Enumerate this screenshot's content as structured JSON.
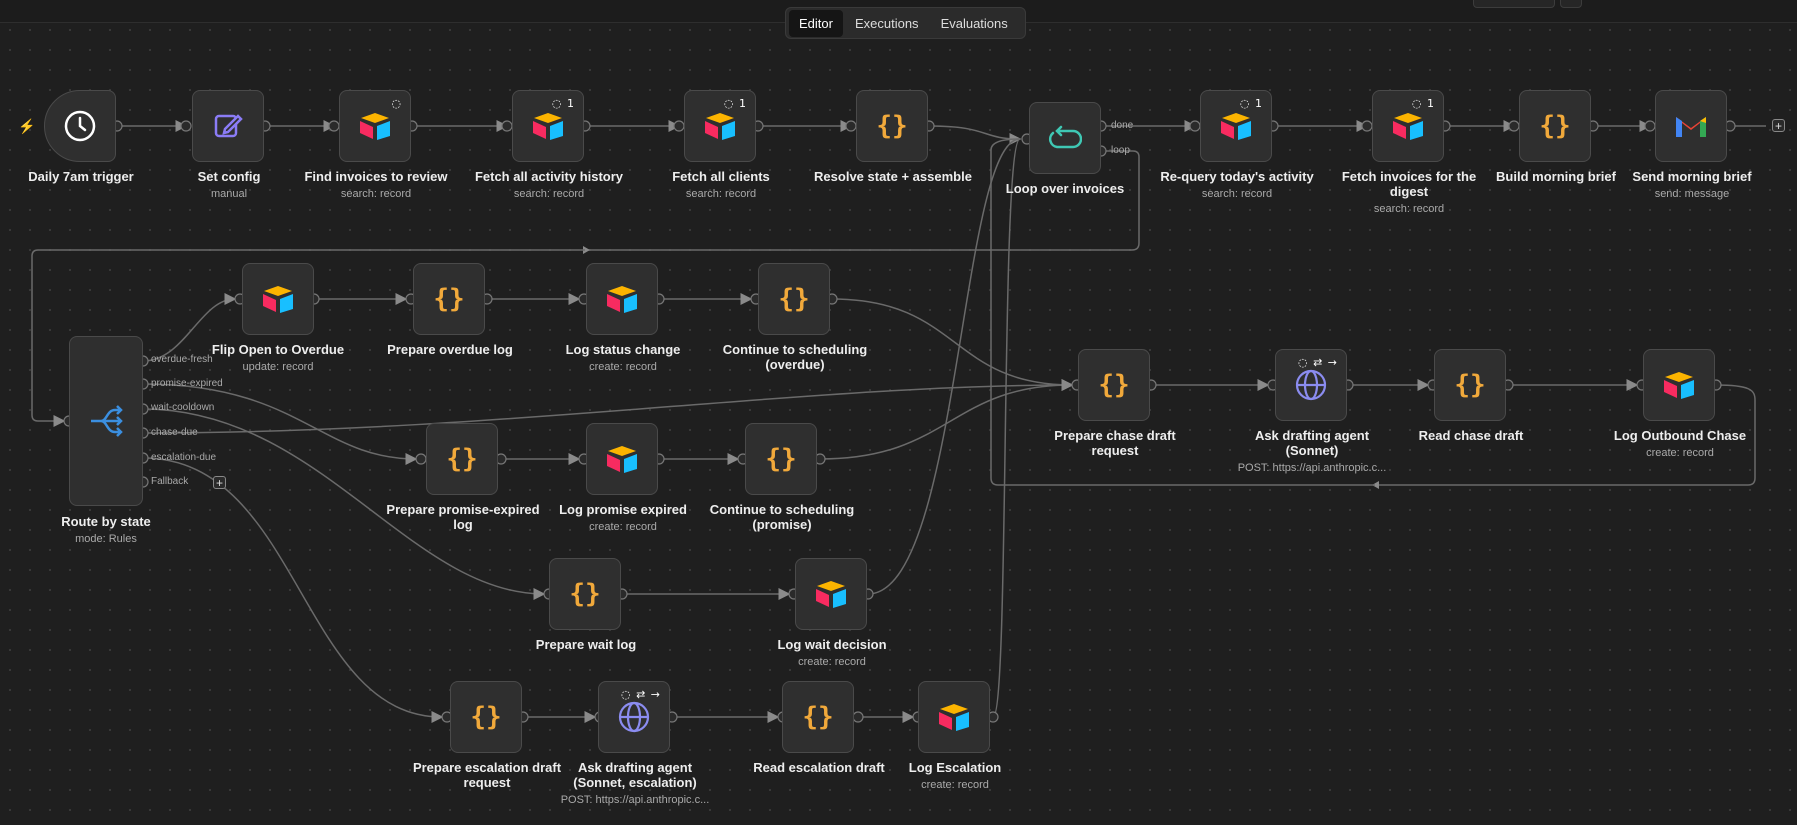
{
  "tabs": [
    {
      "label": "Editor",
      "active": true
    },
    {
      "label": "Executions",
      "active": false
    },
    {
      "label": "Evaluations",
      "active": false
    }
  ],
  "nodes": {
    "daily_trigger": {
      "title": "Daily 7am trigger",
      "icon": "clock-icon"
    },
    "set_config": {
      "title": "Set config",
      "subtitle": "manual",
      "icon": "edit-icon"
    },
    "find_invoices": {
      "title": "Find invoices to review",
      "subtitle": "search: record",
      "icon": "airtable-icon",
      "badge": "◌"
    },
    "fetch_activity": {
      "title": "Fetch all activity history",
      "subtitle": "search: record",
      "icon": "airtable-icon",
      "badge": "◌ 1"
    },
    "fetch_clients": {
      "title": "Fetch all clients",
      "subtitle": "search: record",
      "icon": "airtable-icon",
      "badge": "◌ 1"
    },
    "resolve_state": {
      "title": "Resolve state + assemble",
      "icon": "code-braces-icon"
    },
    "loop_invoices": {
      "title": "Loop over invoices",
      "icon": "loop-icon",
      "port_done": "done",
      "port_loop": "loop"
    },
    "requery_activity": {
      "title": "Re-query today's activity",
      "subtitle": "search: record",
      "icon": "airtable-icon",
      "badge": "◌ 1"
    },
    "fetch_digest": {
      "title": "Fetch invoices for the digest",
      "subtitle": "search: record",
      "icon": "airtable-icon",
      "badge": "◌ 1"
    },
    "build_brief": {
      "title": "Build morning brief",
      "icon": "code-braces-icon"
    },
    "send_brief": {
      "title": "Send morning brief",
      "subtitle": "send: message",
      "icon": "gmail-icon"
    },
    "route_state": {
      "title": "Route by state",
      "subtitle": "mode: Rules",
      "icon": "route-icon",
      "outputs": [
        "overdue-fresh",
        "promise-expired",
        "wait-cooldown",
        "chase-due",
        "escalation-due",
        "Fallback"
      ]
    },
    "flip_overdue": {
      "title": "Flip Open to Overdue",
      "subtitle": "update: record",
      "icon": "airtable-icon"
    },
    "prepare_overdue_log": {
      "title": "Prepare overdue log",
      "icon": "code-braces-icon"
    },
    "log_status_change": {
      "title": "Log status change",
      "subtitle": "create: record",
      "icon": "airtable-icon"
    },
    "continue_overdue": {
      "title": "Continue to scheduling (overdue)",
      "icon": "code-braces-icon"
    },
    "prepare_promise": {
      "title": "Prepare promise-expired log",
      "icon": "code-braces-icon"
    },
    "log_promise": {
      "title": "Log promise expired",
      "subtitle": "create: record",
      "icon": "airtable-icon"
    },
    "continue_promise": {
      "title": "Continue to scheduling (promise)",
      "icon": "code-braces-icon"
    },
    "prepare_wait": {
      "title": "Prepare wait log",
      "icon": "code-braces-icon"
    },
    "log_wait": {
      "title": "Log wait decision",
      "subtitle": "create: record",
      "icon": "airtable-icon"
    },
    "prepare_escalation": {
      "title": "Prepare escalation draft request",
      "icon": "code-braces-icon"
    },
    "ask_escalation": {
      "title": "Ask drafting agent (Sonnet, escalation)",
      "subtitle": "POST: https://api.anthropic.c...",
      "icon": "globe-icon",
      "badge": "◌ ⇄ →"
    },
    "read_escalation": {
      "title": "Read escalation draft",
      "icon": "code-braces-icon"
    },
    "log_escalation": {
      "title": "Log Escalation",
      "subtitle": "create: record",
      "icon": "airtable-icon"
    },
    "prepare_chase": {
      "title": "Prepare chase draft request",
      "icon": "code-braces-icon"
    },
    "ask_sonnet": {
      "title": "Ask drafting agent (Sonnet)",
      "subtitle": "POST: https://api.anthropic.c...",
      "icon": "globe-icon",
      "badge": "◌ ⇄ →"
    },
    "read_chase": {
      "title": "Read chase draft",
      "icon": "code-braces-icon"
    },
    "log_outbound": {
      "title": "Log Outbound Chase",
      "subtitle": "create: record",
      "icon": "airtable-icon"
    }
  },
  "colors": {
    "braces": "#f1a93b",
    "edit": "#8b7cf6",
    "loop": "#3fc8b4",
    "route": "#3b8fe0",
    "globe": "#8b8cf0",
    "trigger_bolt": "#f07d2a"
  }
}
